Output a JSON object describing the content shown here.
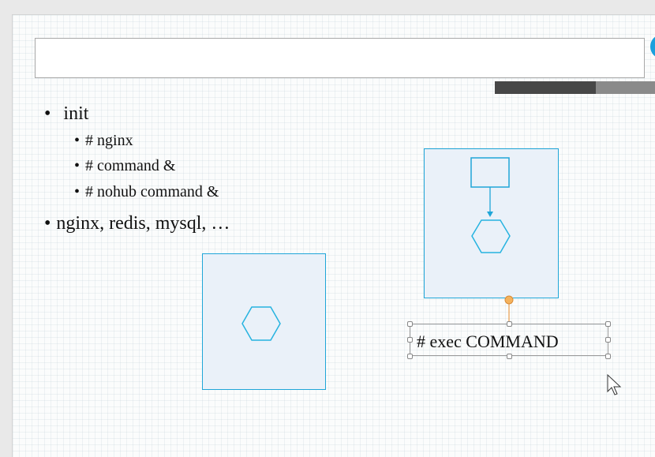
{
  "slide": {
    "title_placeholder": "",
    "bullets": [
      {
        "level": 1,
        "text": "init"
      },
      {
        "level": 2,
        "text": "# nginx"
      },
      {
        "level": 2,
        "text": "# command &"
      },
      {
        "level": 2,
        "text": "# nohub command &"
      },
      {
        "level": 1,
        "text": "nginx, redis, mysql, …"
      }
    ],
    "bullet_glyph": "•",
    "text_box_label": "# exec COMMAND"
  },
  "colors": {
    "shape_border": "#1fa6d8",
    "shape_fill": "#eaf1f9",
    "rotation_handle": "#f5b25c",
    "accent_circle": "#1aa0dd"
  },
  "icons": {
    "cursor": "mouse-pointer-icon",
    "hexagon": "hexagon-icon"
  }
}
